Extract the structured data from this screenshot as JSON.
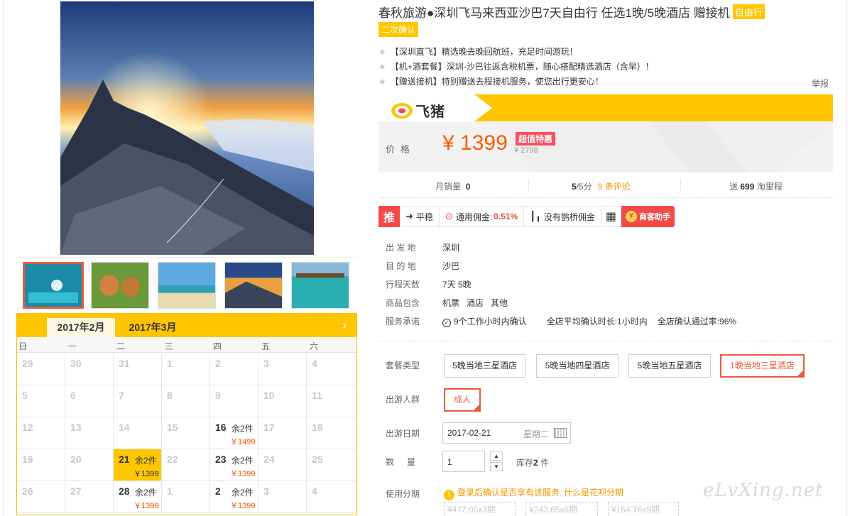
{
  "product": {
    "title": "春秋旅游●深圳飞马来西亚沙巴7天自由行 任选1晚/5晚酒店 赠接机",
    "type_tag": "自由行",
    "confirm_tag": "二次确认",
    "features": [
      "【深圳直飞】精选晚去晚回航班，充足时间游玩！",
      "【机+酒套餐】深圳-沙巴往返含税机票，随心搭配精选酒店（含早）！",
      "【赠送接机】特别赠送去程接机服务，使您出行更安心！"
    ],
    "report_label": "举报"
  },
  "price": {
    "brand": "飞猪",
    "label": "价格",
    "current": "¥ 1399",
    "badge": "超值特惠",
    "original": "¥ 2798"
  },
  "stats": {
    "monthly_label": "月销量",
    "monthly_value": "0",
    "rating_value": "5",
    "rating_suffix": "/5分",
    "reviews": "9 条评论",
    "mileage_prefix": "送",
    "mileage_value": "699",
    "mileage_suffix": "淘里程"
  },
  "toolbar": {
    "push": "推",
    "trend": "平稳",
    "commission_label": "通用佣金:",
    "commission_value": "0.51%",
    "bridge": "没有鹊桥佣金",
    "helper": "商客助手"
  },
  "details": [
    {
      "label": "出 发 地",
      "values": [
        "深圳"
      ]
    },
    {
      "label": "目 的 地",
      "values": [
        "沙巴"
      ]
    },
    {
      "label": "行程天数",
      "values": [
        "7天 5晚"
      ]
    },
    {
      "label": "商品包含",
      "values": [
        "机票",
        "酒店",
        "其他"
      ]
    },
    {
      "label": "服务承诺",
      "values": [
        "9个工作小时内确认",
        "全店平均确认时长:1小时内",
        "全店确认通过率:96%"
      ]
    }
  ],
  "options": {
    "package_label": "套餐类型",
    "packages": [
      "5晚当地三星酒店",
      "5晚当地四星酒店",
      "5晚当地五星酒店",
      "1晚当地三星酒店"
    ],
    "selected_package": 3,
    "crowd_label": "出游人群",
    "crowd": "成人",
    "date_label": "出游日期",
    "date": "2017-02-21",
    "weekday": "星期二",
    "qty_label": "数量",
    "qty": "1",
    "stock_prefix": "库存",
    "stock_value": "2",
    "stock_suffix": "件",
    "installment_label": "使用分期",
    "installment_note": "登录后确认是否享有该服务",
    "installment_link": "什么是花呗分期",
    "installments": [
      "¥477.05x3期",
      "¥243.65x6期",
      "¥164.76x9期"
    ]
  },
  "calendar": {
    "tabs": [
      "2017年2月",
      "2017年3月"
    ],
    "active_tab": 0,
    "weekdays": [
      "日",
      "一",
      "二",
      "三",
      "四",
      "五",
      "六"
    ],
    "weeks": [
      [
        {
          "d": "29"
        },
        {
          "d": "30"
        },
        {
          "d": "31"
        },
        {
          "d": "1"
        },
        {
          "d": "2"
        },
        {
          "d": "3"
        },
        {
          "d": "4"
        }
      ],
      [
        {
          "d": "5"
        },
        {
          "d": "6"
        },
        {
          "d": "7"
        },
        {
          "d": "8"
        },
        {
          "d": "9"
        },
        {
          "d": "10"
        },
        {
          "d": "11"
        }
      ],
      [
        {
          "d": "12"
        },
        {
          "d": "13"
        },
        {
          "d": "14"
        },
        {
          "d": "15"
        },
        {
          "d": "16",
          "rem": "余2件",
          "price": "￥1499"
        },
        {
          "d": "17"
        },
        {
          "d": "18"
        }
      ],
      [
        {
          "d": "19"
        },
        {
          "d": "20"
        },
        {
          "d": "21",
          "rem": "余2件",
          "price": "￥1399",
          "selected": true
        },
        {
          "d": "22"
        },
        {
          "d": "23",
          "rem": "余2件",
          "price": "￥1399"
        },
        {
          "d": "24"
        },
        {
          "d": "25"
        }
      ],
      [
        {
          "d": "26"
        },
        {
          "d": "27"
        },
        {
          "d": "28",
          "rem": "余2件",
          "price": "￥1399"
        },
        {
          "d": "1"
        },
        {
          "d": "2",
          "rem": "余2件",
          "price": "￥1399"
        },
        {
          "d": "3"
        },
        {
          "d": "4"
        }
      ]
    ]
  },
  "watermark": "eLvXing.net",
  "colors": {
    "accent_yellow": "#ffc600",
    "price_orange": "#ff5a00",
    "select_red": "#e85c3a",
    "push_red": "#f24a4a"
  }
}
